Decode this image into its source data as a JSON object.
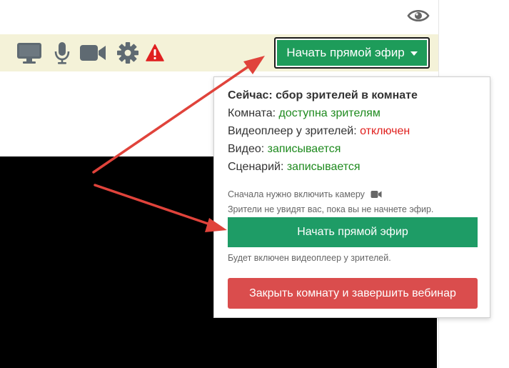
{
  "toolbar": {
    "start_broadcast_label": "Начать прямой эфир",
    "icons": [
      "monitor-icon",
      "microphone-icon",
      "camera-icon",
      "gear-icon",
      "warning-icon"
    ]
  },
  "header": {
    "icons": [
      "eye-icon"
    ]
  },
  "dropdown": {
    "status_title": "Сейчас: сбор зрителей в комнате",
    "room_label": "Комната:",
    "room_value": "доступна зрителям",
    "player_label": "Видеоплеер у зрителей:",
    "player_value": "отключен",
    "video_label": "Видео:",
    "video_value": "записывается",
    "scenario_label": "Сценарий:",
    "scenario_value": "записывается",
    "camera_note": "Сначала нужно включить камеру",
    "viewers_note": "Зрители не увидят вас, пока вы не начнете эфир.",
    "start_button": "Начать прямой эфир",
    "player_note": "Будет включен видеоплеер у зрителей.",
    "close_button": "Закрыть комнату и завершить вебинар"
  },
  "colors": {
    "toolbar_bg": "#f4f2d8",
    "primary_green": "#1e9c5a",
    "status_green": "#1e8a1e",
    "status_red": "#e0201e",
    "danger": "#da4d4d",
    "annotation_arrow": "#e0433b"
  }
}
